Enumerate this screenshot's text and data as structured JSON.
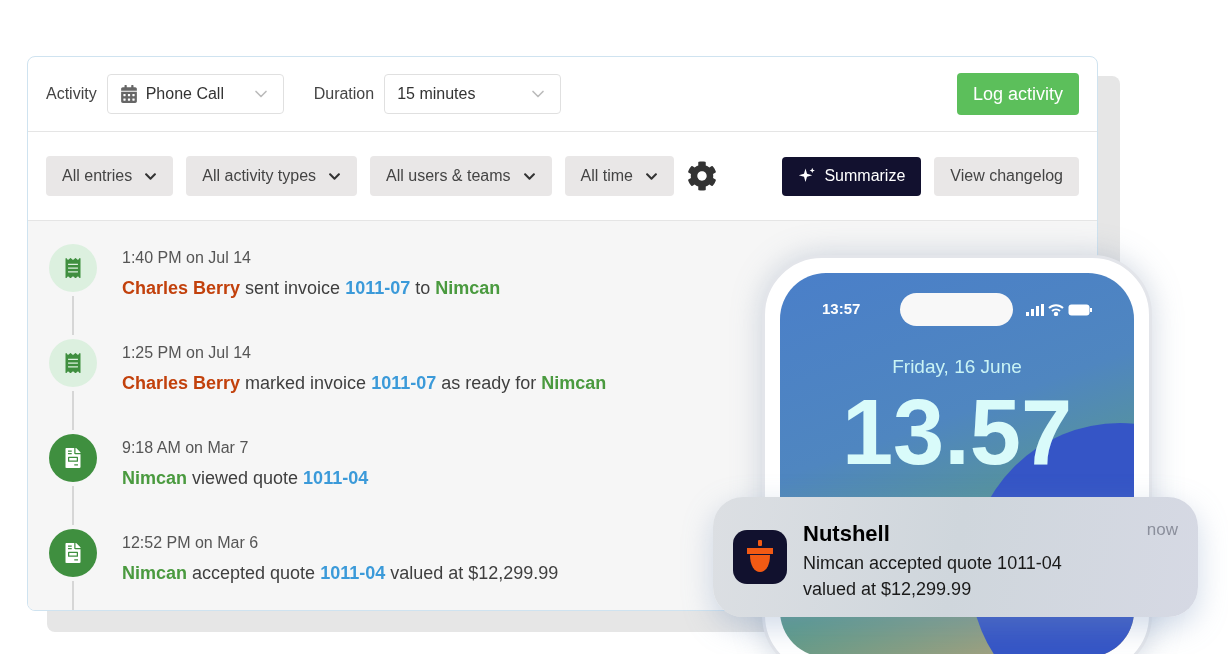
{
  "activity_bar": {
    "activity_label": "Activity",
    "activity_value": "Phone Call",
    "duration_label": "Duration",
    "duration_value": "15 minutes",
    "log_button": "Log activity"
  },
  "filters": [
    {
      "label": "All entries"
    },
    {
      "label": "All activity types"
    },
    {
      "label": "All users & teams"
    },
    {
      "label": "All time"
    }
  ],
  "summarize_button": "Summarize",
  "changelog_button": "View changelog",
  "timeline": [
    {
      "kind": "invoice",
      "time": "1:40 PM on Jul 14",
      "parts": [
        {
          "kind": "person",
          "text": "Charles Berry"
        },
        {
          "kind": "plain",
          "text": "sent invoice"
        },
        {
          "kind": "link",
          "text": "1011-07"
        },
        {
          "kind": "plain",
          "text": "to"
        },
        {
          "kind": "company",
          "text": "Nimcan"
        }
      ]
    },
    {
      "kind": "invoice",
      "time": "1:25 PM on Jul 14",
      "parts": [
        {
          "kind": "person",
          "text": "Charles Berry"
        },
        {
          "kind": "plain",
          "text": "marked invoice"
        },
        {
          "kind": "link",
          "text": "1011-07"
        },
        {
          "kind": "plain",
          "text": "as ready for"
        },
        {
          "kind": "company",
          "text": "Nimcan"
        }
      ]
    },
    {
      "kind": "quote",
      "time": "9:18 AM on Mar 7",
      "parts": [
        {
          "kind": "company",
          "text": "Nimcan"
        },
        {
          "kind": "plain",
          "text": "viewed quote"
        },
        {
          "kind": "link",
          "text": "1011-04"
        }
      ]
    },
    {
      "kind": "quote",
      "time": "12:52 PM on Mar 6",
      "parts": [
        {
          "kind": "company",
          "text": "Nimcan"
        },
        {
          "kind": "plain",
          "text": "accepted quote"
        },
        {
          "kind": "link",
          "text": "1011-04"
        },
        {
          "kind": "plain",
          "text": "valued at $12,299.99"
        }
      ]
    }
  ],
  "phone": {
    "status_time": "13:57",
    "date": "Friday, 16 June",
    "clock": "13.57"
  },
  "notification": {
    "app": "Nutshell",
    "time": "now",
    "message": "Nimcan accepted quote 1011-04 valued at $12,299.99"
  }
}
